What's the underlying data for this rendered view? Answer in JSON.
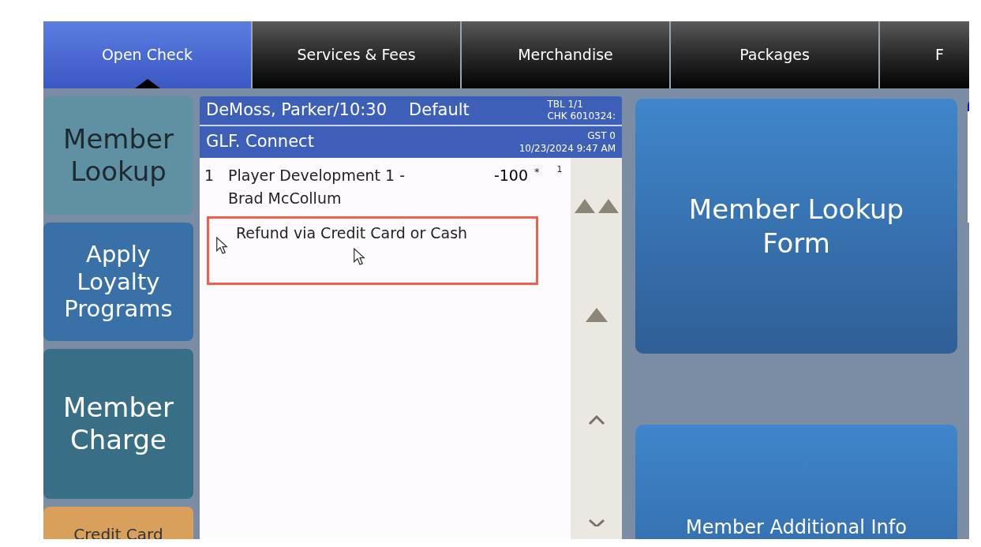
{
  "tabs": [
    {
      "label": "Open Check",
      "selected": true
    },
    {
      "label": "Services & Fees",
      "selected": false
    },
    {
      "label": "Merchandise",
      "selected": false
    },
    {
      "label": "Packages",
      "selected": false
    },
    {
      "label": "F",
      "selected": false
    }
  ],
  "left_buttons": [
    {
      "label": "Member Lookup",
      "color": "#5f91a2"
    },
    {
      "label": "Apply Loyalty Programs",
      "color": "#3a70a8"
    },
    {
      "label": "Member Charge",
      "color": "#396f86"
    },
    {
      "label": "Credit Card",
      "color": "#d9a05c"
    }
  ],
  "check": {
    "header": {
      "guest_time": "DeMoss, Parker/10:30",
      "profile": "Default",
      "table": "TBL 1/1",
      "check_number": "CHK 6010324:",
      "revenue_center": "GLF. Connect",
      "guests": "GST 0",
      "datetime": "10/23/2024 9:47 AM"
    },
    "items": [
      {
        "quantity": "1",
        "name": "Player Development 1 - Brad McCollum",
        "amount": "-100",
        "flag": "*",
        "seat": "1"
      }
    ],
    "note": "Refund via Credit Card or Cash",
    "highlighted": true
  },
  "right_buttons": [
    {
      "label": "Member Lookup Form"
    },
    {
      "label": "Member Additional Info"
    }
  ]
}
